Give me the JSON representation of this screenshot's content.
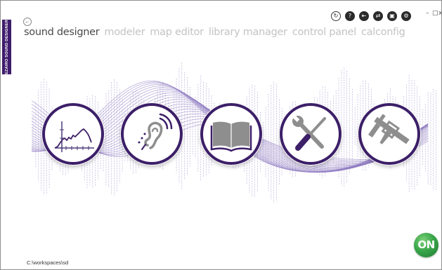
{
  "sidebar": {
    "vertical_label": "EZAIRO SOUND DESIGNER"
  },
  "nav": {
    "back_icon": "back-arrow-icon",
    "items": [
      {
        "label": "sound designer",
        "active": true
      },
      {
        "label": "modeler",
        "active": false
      },
      {
        "label": "map editor",
        "active": false
      },
      {
        "label": "library manager",
        "active": false
      },
      {
        "label": "control panel",
        "active": false
      },
      {
        "label": "calconfig",
        "active": false
      }
    ]
  },
  "toolbar": {
    "icons": [
      "refresh-icon",
      "help-icon",
      "import-icon",
      "sync-icon",
      "screen-icon",
      "settings-icon"
    ],
    "window_controls": {
      "minimize": "–",
      "maximize": "□",
      "close": "x"
    }
  },
  "tools": [
    {
      "name": "sound-designer-tool",
      "icon": "frequency-response-graph-icon"
    },
    {
      "name": "modeler-tool",
      "icon": "ear-sound-icon"
    },
    {
      "name": "library-manager-tool",
      "icon": "open-book-icon"
    },
    {
      "name": "control-panel-tool",
      "icon": "wrench-screwdriver-icon"
    },
    {
      "name": "calconfig-tool",
      "icon": "caliper-icon"
    }
  ],
  "status": {
    "workspace_path": "C:\\workspaces\\sd"
  },
  "brand": {
    "logo_text": "ON"
  },
  "colors": {
    "accent": "#3c1f68",
    "wave": "#8c78c0",
    "inactive_nav": "#c3c3c3",
    "brand_green": "#3aa64a"
  }
}
